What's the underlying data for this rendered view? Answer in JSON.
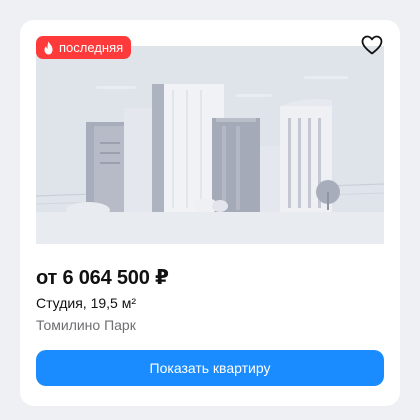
{
  "card": {
    "badge": {
      "label": "последняя",
      "icon": "fire-icon",
      "color": "#ff3a3a"
    },
    "favorite": {
      "icon": "heart-icon"
    },
    "image": {
      "icon": "buildings-placeholder-image"
    },
    "price": "от 6 064 500 ₽",
    "apartment": "Студия, 19,5 м²",
    "project": "Томилино Парк",
    "cta_label": "Показать квартиру",
    "accent_color": "#1a8cff"
  }
}
